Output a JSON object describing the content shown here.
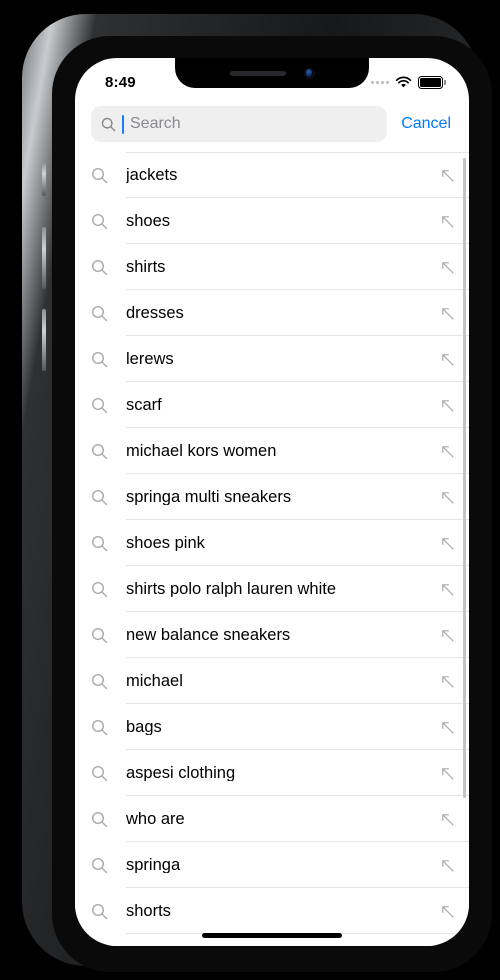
{
  "device": {
    "notch": {
      "speaker_icon": "speaker-slot",
      "camera_icon": "front-camera"
    },
    "buttons": {
      "silent_switch": "silent-switch",
      "volume_up": "volume-up-button",
      "volume_down": "volume-down-button",
      "power": "power-button"
    },
    "home_indicator": "home-indicator"
  },
  "status_bar": {
    "time": "8:49",
    "signal_icon": "cellular-dots-icon",
    "wifi_icon": "wifi-icon",
    "battery_icon": "battery-full-icon"
  },
  "search": {
    "placeholder": "Search",
    "value": "",
    "icon": "search-icon",
    "caret": "text-caret",
    "cancel_label": "Cancel"
  },
  "colors": {
    "accent_blue": "#007aff",
    "caret_blue": "#1c7cff",
    "field_bg": "#efeff0",
    "separator": "#e6e6e8",
    "icon_gray": "#8a8a8e",
    "text_black": "#000000"
  },
  "suggestions": {
    "row_icon": "search-icon",
    "fill_icon": "arrow-up-left-icon",
    "items": [
      {
        "label": "jackets"
      },
      {
        "label": "shoes"
      },
      {
        "label": "shirts"
      },
      {
        "label": "dresses"
      },
      {
        "label": "lerews"
      },
      {
        "label": "scarf"
      },
      {
        "label": "michael kors women"
      },
      {
        "label": "springa multi sneakers"
      },
      {
        "label": "shoes pink"
      },
      {
        "label": "shirts polo ralph lauren white"
      },
      {
        "label": "new balance sneakers"
      },
      {
        "label": "michael"
      },
      {
        "label": "bags"
      },
      {
        "label": "aspesi clothing"
      },
      {
        "label": "who are"
      },
      {
        "label": "springa"
      },
      {
        "label": "shorts"
      }
    ]
  },
  "scrollbar": {
    "name": "vertical-scroll-indicator"
  }
}
